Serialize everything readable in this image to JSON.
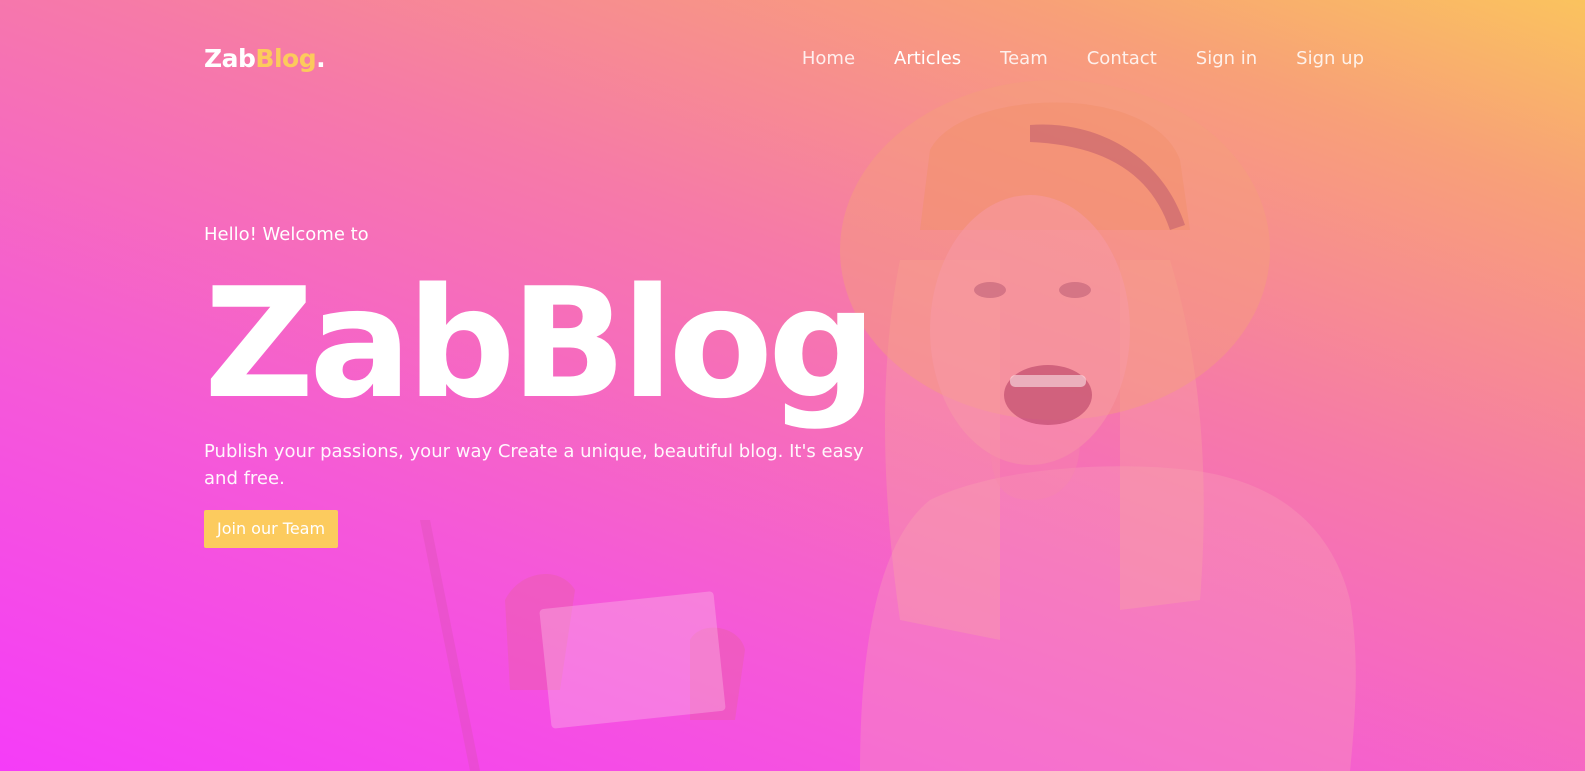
{
  "brand": {
    "name_main": "Zab",
    "name_accent": "Blog",
    "name_dot": ".",
    "accent_color": "#fcca5c"
  },
  "nav": {
    "items": [
      {
        "label": "Home"
      },
      {
        "label": "Articles"
      },
      {
        "label": "Team"
      },
      {
        "label": "Contact"
      },
      {
        "label": "Sign in"
      },
      {
        "label": "Sign up"
      }
    ]
  },
  "hero": {
    "welcome": "Hello! Welcome to",
    "title": "ZabBlog",
    "tagline": "Publish your passions, your way Create a unique, beautiful blog. It's easy and free.",
    "cta_label": "Join our Team"
  },
  "colors": {
    "gradient_start": "#f53cf8",
    "gradient_end": "#fac35e",
    "button": "#fccb5e"
  }
}
